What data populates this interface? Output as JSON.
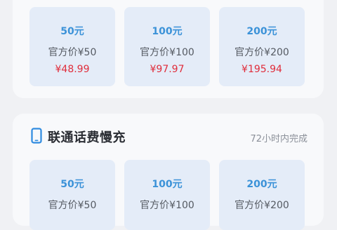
{
  "top_cards": [
    {
      "face": "50元",
      "official": "官方价¥50",
      "price": "¥48.99"
    },
    {
      "face": "100元",
      "official": "官方价¥100",
      "price": "¥97.97"
    },
    {
      "face": "200元",
      "official": "官方价¥200",
      "price": "¥195.94"
    }
  ],
  "section": {
    "icon": "phone-icon",
    "title": "联通话费慢充",
    "eta": "72小时内完成"
  },
  "bottom_cards": [
    {
      "face": "50元",
      "official": "官方价¥50"
    },
    {
      "face": "100元",
      "official": "官方价¥100"
    },
    {
      "face": "200元",
      "official": "官方价¥200"
    }
  ],
  "colors": {
    "face_blue": "#3b92d8",
    "price_red": "#e02d3b",
    "card_bg": "#e4ecf8"
  }
}
